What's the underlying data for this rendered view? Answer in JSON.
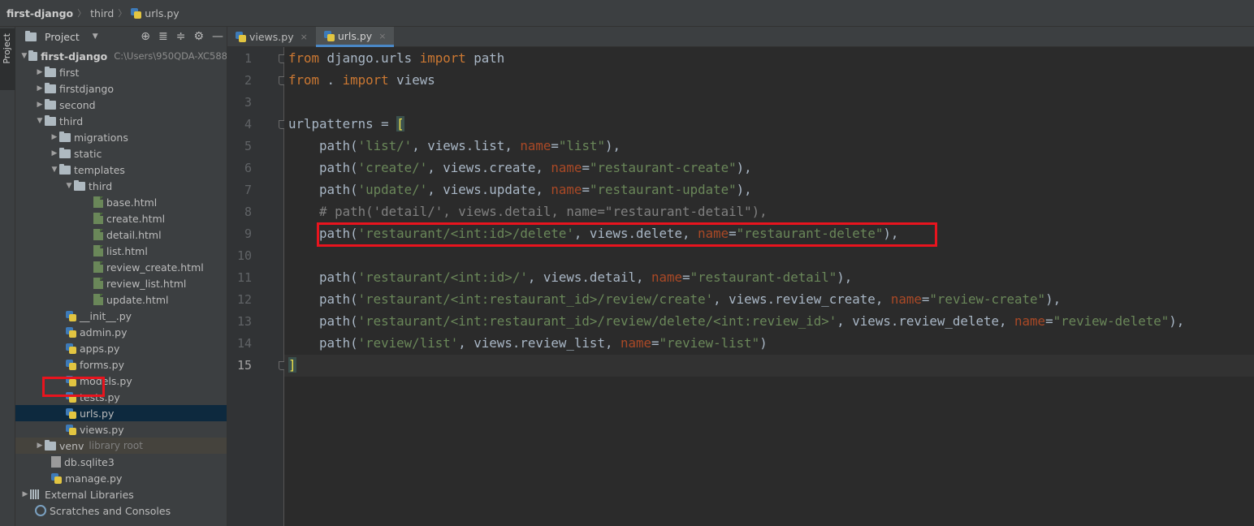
{
  "breadcrumb": [
    "first-django",
    "third",
    "urls.py"
  ],
  "tool_strip": {
    "project_label": "Project"
  },
  "panel": {
    "title": "Project"
  },
  "tree": [
    {
      "label": "first-django",
      "hint": "C:\\Users\\950QDA-XC588"
    },
    {
      "label": "first"
    },
    {
      "label": "firstdjango"
    },
    {
      "label": "second"
    },
    {
      "label": "third"
    },
    {
      "label": "migrations"
    },
    {
      "label": "static"
    },
    {
      "label": "templates"
    },
    {
      "label": "third"
    },
    {
      "label": "base.html"
    },
    {
      "label": "create.html"
    },
    {
      "label": "detail.html"
    },
    {
      "label": "list.html"
    },
    {
      "label": "review_create.html"
    },
    {
      "label": "review_list.html"
    },
    {
      "label": "update.html"
    },
    {
      "label": "__init__.py"
    },
    {
      "label": "admin.py"
    },
    {
      "label": "apps.py"
    },
    {
      "label": "forms.py"
    },
    {
      "label": "models.py"
    },
    {
      "label": "tests.py"
    },
    {
      "label": "urls.py"
    },
    {
      "label": "views.py"
    },
    {
      "label": "venv",
      "hint": "library root"
    },
    {
      "label": "db.sqlite3"
    },
    {
      "label": "manage.py"
    },
    {
      "label": "External Libraries"
    },
    {
      "label": "Scratches and Consoles"
    }
  ],
  "tabs": [
    {
      "label": "views.py",
      "close": "×"
    },
    {
      "label": "urls.py",
      "close": "×"
    }
  ],
  "line_numbers": [
    "1",
    "2",
    "3",
    "4",
    "5",
    "6",
    "7",
    "8",
    "9",
    "10",
    "11",
    "12",
    "13",
    "14",
    "15"
  ],
  "code": {
    "l1": {
      "kw1": "from",
      "mod": " django.urls ",
      "kw2": "import",
      "name": " path"
    },
    "l2": {
      "kw1": "from",
      "mod": " . ",
      "kw2": "import",
      "name": " views"
    },
    "l4": {
      "text": "urlpatterns = ",
      "bracket": "["
    },
    "l5": {
      "a": "    path(",
      "s1": "'list/'",
      "b": ", views.list, ",
      "p": "name",
      "c": "=",
      "s2": "\"list\"",
      "d": "),"
    },
    "l6": {
      "a": "    path(",
      "s1": "'create/'",
      "b": ", views.create, ",
      "p": "name",
      "c": "=",
      "s2": "\"restaurant-create\"",
      "d": "),"
    },
    "l7": {
      "a": "    path(",
      "s1": "'update/'",
      "b": ", views.update, ",
      "p": "name",
      "c": "=",
      "s2": "\"restaurant-update\"",
      "d": "),"
    },
    "l8": {
      "comment": "    # path('detail/', views.detail, name=\"restaurant-detail\"),"
    },
    "l9": {
      "a": "    path(",
      "s1": "'restaurant/<int:id>/delete'",
      "b": ", views.delete, ",
      "p": "name",
      "c": "=",
      "s2": "\"restaurant-delete\"",
      "d": "),"
    },
    "l11": {
      "a": "    path(",
      "s1": "'restaurant/<int:id>/'",
      "b": ", views.detail, ",
      "p": "name",
      "c": "=",
      "s2": "\"restaurant-detail\"",
      "d": "),"
    },
    "l12": {
      "a": "    path(",
      "s1": "'restaurant/<int:restaurant_id>/review/create'",
      "b": ", views.review_create, ",
      "p": "name",
      "c": "=",
      "s2": "\"review-create\"",
      "d": "),"
    },
    "l13": {
      "a": "    path(",
      "s1": "'restaurant/<int:restaurant_id>/review/delete/<int:review_id>'",
      "b": ", views.review_delete, ",
      "p": "name",
      "c": "=",
      "s2": "\"review-delete\"",
      "d": "),"
    },
    "l14": {
      "a": "    path(",
      "s1": "'review/list'",
      "b": ", views.review_list, ",
      "p": "name",
      "c": "=",
      "s2": "\"review-list\"",
      "d": ")"
    },
    "l15": {
      "bracket": "]"
    }
  },
  "colors": {
    "keyword": "#cc7832",
    "string": "#6a8759",
    "param": "#aa4926",
    "comment": "#808080",
    "highlight_box": "#e8141e"
  }
}
